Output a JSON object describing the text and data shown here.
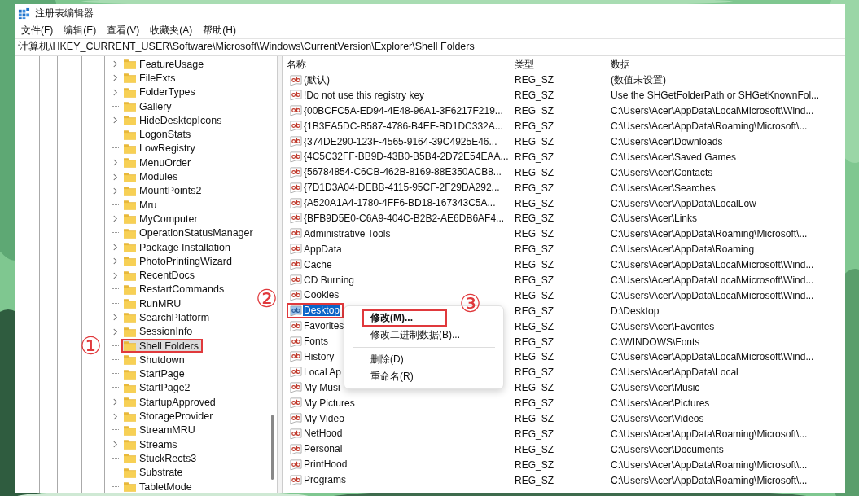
{
  "window": {
    "title": "注册表编辑器"
  },
  "menu_bar": [
    "文件(F)",
    "编辑(E)",
    "查看(V)",
    "收藏夹(A)",
    "帮助(H)"
  ],
  "address_bar": {
    "value": "计算机\\HKEY_CURRENT_USER\\Software\\Microsoft\\Windows\\CurrentVersion\\Explorer\\Shell Folders"
  },
  "tree": {
    "items": [
      {
        "name": "FeatureUsage",
        "has_children": true,
        "selected": false
      },
      {
        "name": "FileExts",
        "has_children": true,
        "selected": false
      },
      {
        "name": "FolderTypes",
        "has_children": true,
        "selected": false
      },
      {
        "name": "Gallery",
        "has_children": false,
        "selected": false
      },
      {
        "name": "HideDesktopIcons",
        "has_children": true,
        "selected": false
      },
      {
        "name": "LogonStats",
        "has_children": false,
        "selected": false
      },
      {
        "name": "LowRegistry",
        "has_children": false,
        "selected": false
      },
      {
        "name": "MenuOrder",
        "has_children": true,
        "selected": false
      },
      {
        "name": "Modules",
        "has_children": true,
        "selected": false
      },
      {
        "name": "MountPoints2",
        "has_children": true,
        "selected": false
      },
      {
        "name": "Mru",
        "has_children": false,
        "selected": false
      },
      {
        "name": "MyComputer",
        "has_children": true,
        "selected": false
      },
      {
        "name": "OperationStatusManager",
        "has_children": false,
        "selected": false
      },
      {
        "name": "Package Installation",
        "has_children": true,
        "selected": false
      },
      {
        "name": "PhotoPrintingWizard",
        "has_children": true,
        "selected": false
      },
      {
        "name": "RecentDocs",
        "has_children": true,
        "selected": false
      },
      {
        "name": "RestartCommands",
        "has_children": false,
        "selected": false
      },
      {
        "name": "RunMRU",
        "has_children": false,
        "selected": false
      },
      {
        "name": "SearchPlatform",
        "has_children": true,
        "selected": false
      },
      {
        "name": "SessionInfo",
        "has_children": true,
        "selected": false
      },
      {
        "name": "Shell Folders",
        "has_children": false,
        "selected": true,
        "callout": "①"
      },
      {
        "name": "Shutdown",
        "has_children": false,
        "selected": false
      },
      {
        "name": "StartPage",
        "has_children": false,
        "selected": false
      },
      {
        "name": "StartPage2",
        "has_children": false,
        "selected": false
      },
      {
        "name": "StartupApproved",
        "has_children": true,
        "selected": false
      },
      {
        "name": "StorageProvider",
        "has_children": true,
        "selected": false
      },
      {
        "name": "StreamMRU",
        "has_children": false,
        "selected": false
      },
      {
        "name": "Streams",
        "has_children": true,
        "selected": false
      },
      {
        "name": "StuckRects3",
        "has_children": false,
        "selected": false
      },
      {
        "name": "Substrate",
        "has_children": false,
        "selected": false
      },
      {
        "name": "TabletMode",
        "has_children": false,
        "selected": false
      }
    ]
  },
  "values": {
    "columns": [
      "名称",
      "类型",
      "数据"
    ],
    "rows": [
      {
        "name": "(默认)",
        "type": "REG_SZ",
        "data": "(数值未设置)",
        "selected": false
      },
      {
        "name": "!Do not use this registry key",
        "type": "REG_SZ",
        "data": "Use the SHGetFolderPath or SHGetKnownFol...",
        "selected": false
      },
      {
        "name": "{00BCFC5A-ED94-4E48-96A1-3F6217F219...",
        "type": "REG_SZ",
        "data": "C:\\Users\\Acer\\AppData\\Local\\Microsoft\\Wind...",
        "selected": false
      },
      {
        "name": "{1B3EA5DC-B587-4786-B4EF-BD1DC332A...",
        "type": "REG_SZ",
        "data": "C:\\Users\\Acer\\AppData\\Roaming\\Microsoft\\...",
        "selected": false
      },
      {
        "name": "{374DE290-123F-4565-9164-39C4925E46...",
        "type": "REG_SZ",
        "data": "C:\\Users\\Acer\\Downloads",
        "selected": false
      },
      {
        "name": "{4C5C32FF-BB9D-43B0-B5B4-2D72E54EAA...",
        "type": "REG_SZ",
        "data": "C:\\Users\\Acer\\Saved Games",
        "selected": false
      },
      {
        "name": "{56784854-C6CB-462B-8169-88E350ACB8...",
        "type": "REG_SZ",
        "data": "C:\\Users\\Acer\\Contacts",
        "selected": false
      },
      {
        "name": "{7D1D3A04-DEBB-4115-95CF-2F29DA292...",
        "type": "REG_SZ",
        "data": "C:\\Users\\Acer\\Searches",
        "selected": false
      },
      {
        "name": "{A520A1A4-1780-4FF6-BD18-167343C5A...",
        "type": "REG_SZ",
        "data": "C:\\Users\\Acer\\AppData\\LocalLow",
        "selected": false
      },
      {
        "name": "{BFB9D5E0-C6A9-404C-B2B2-AE6DB6AF4...",
        "type": "REG_SZ",
        "data": "C:\\Users\\Acer\\Links",
        "selected": false
      },
      {
        "name": "Administrative Tools",
        "type": "REG_SZ",
        "data": "C:\\Users\\Acer\\AppData\\Roaming\\Microsoft\\...",
        "selected": false
      },
      {
        "name": "AppData",
        "type": "REG_SZ",
        "data": "C:\\Users\\Acer\\AppData\\Roaming",
        "selected": false
      },
      {
        "name": "Cache",
        "type": "REG_SZ",
        "data": "C:\\Users\\Acer\\AppData\\Local\\Microsoft\\Wind...",
        "selected": false
      },
      {
        "name": "CD Burning",
        "type": "REG_SZ",
        "data": "C:\\Users\\Acer\\AppData\\Local\\Microsoft\\Wind...",
        "selected": false
      },
      {
        "name": "Cookies",
        "type": "REG_SZ",
        "data": "C:\\Users\\Acer\\AppData\\Local\\Microsoft\\Wind...",
        "selected": false
      },
      {
        "name": "Desktop",
        "type": "REG_SZ",
        "data": "D:\\Desktop",
        "selected": true,
        "callout": "②"
      },
      {
        "name": "Favorites",
        "type": "REG_SZ",
        "data": "C:\\Users\\Acer\\Favorites",
        "selected": false
      },
      {
        "name": "Fonts",
        "type": "REG_SZ",
        "data": "C:\\WINDOWS\\Fonts",
        "selected": false
      },
      {
        "name": "History",
        "type": "REG_SZ",
        "data": "C:\\Users\\Acer\\AppData\\Local\\Microsoft\\Wind...",
        "selected": false
      },
      {
        "name": "Local Ap",
        "type": "REG_SZ",
        "data": "C:\\Users\\Acer\\AppData\\Local",
        "selected": false
      },
      {
        "name": "My Musi",
        "type": "REG_SZ",
        "data": "C:\\Users\\Acer\\Music",
        "selected": false
      },
      {
        "name": "My Pictures",
        "type": "REG_SZ",
        "data": "C:\\Users\\Acer\\Pictures",
        "selected": false
      },
      {
        "name": "My Video",
        "type": "REG_SZ",
        "data": "C:\\Users\\Acer\\Videos",
        "selected": false
      },
      {
        "name": "NetHood",
        "type": "REG_SZ",
        "data": "C:\\Users\\Acer\\AppData\\Roaming\\Microsoft\\...",
        "selected": false
      },
      {
        "name": "Personal",
        "type": "REG_SZ",
        "data": "C:\\Users\\Acer\\Documents",
        "selected": false
      },
      {
        "name": "PrintHood",
        "type": "REG_SZ",
        "data": "C:\\Users\\Acer\\AppData\\Roaming\\Microsoft\\...",
        "selected": false
      },
      {
        "name": "Programs",
        "type": "REG_SZ",
        "data": "C:\\Users\\Acer\\AppData\\Roaming\\Microsoft\\...",
        "selected": false
      }
    ]
  },
  "context_menu": {
    "items": [
      {
        "kind": "item",
        "label": "修改(M)...",
        "default": true,
        "callout": "③"
      },
      {
        "kind": "item",
        "label": "修改二进制数据(B)...",
        "default": false
      },
      {
        "kind": "separator"
      },
      {
        "kind": "item",
        "label": "删除(D)",
        "default": false
      },
      {
        "kind": "item",
        "label": "重命名(R)",
        "default": false
      }
    ]
  }
}
